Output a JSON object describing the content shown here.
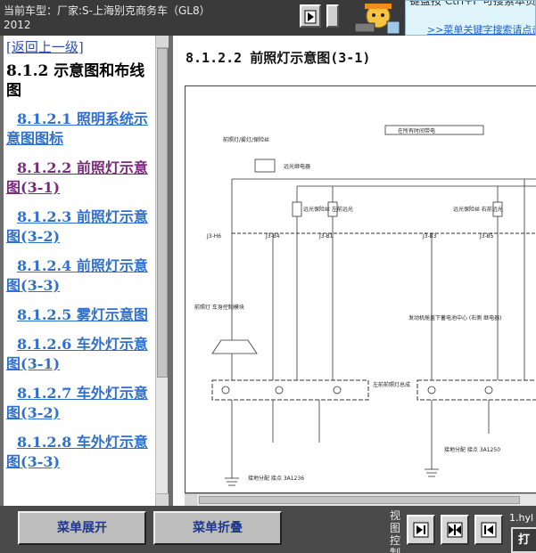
{
  "topbar": {
    "vehicle_line1": "当前车型：厂家:S-上海别克商务车（GL8）",
    "vehicle_line2": "2012",
    "hint_text": "键盘按 Ctrl+F 可搜索本页关键字!",
    "hint_link": ">>菜单关键字搜索请点击"
  },
  "toc": {
    "back_link": "[返回上一级]",
    "heading": "8.1.2 示意图和布线图",
    "items": [
      {
        "label": "8.1.2.1 照明系统示意图图标"
      },
      {
        "label": "8.1.2.2 前照灯示意图(3-1)"
      },
      {
        "label": "8.1.2.3 前照灯示意图(3-2)"
      },
      {
        "label": "8.1.2.4 前照灯示意图(3-3)"
      },
      {
        "label": "8.1.2.5 雾灯示意图"
      },
      {
        "label": "8.1.2.6 车外灯示意图(3-1)"
      },
      {
        "label": "8.1.2.7 车外灯示意图(3-2)"
      },
      {
        "label": "8.1.2.8 车外灯示意图(3-3)"
      }
    ]
  },
  "content": {
    "title": "8.1.2.2 前照灯示意图(3-1)"
  },
  "diagram": {
    "top_label": "在所有时间带电",
    "labels": {
      "fuse_area": "前照灯/雾灯/保险丝",
      "relay": "远光继电器",
      "j3_h6": "J3-H6",
      "j3_b4": "J3-B4",
      "j3_b1": "J3-B1",
      "j3_b3": "J3-B3",
      "j3_b5": "J3-B5",
      "fuse_left": "远光保险丝 左前远光",
      "fuse_right": "远光保险丝 右前远光",
      "left_headlamp_assembly": "左前前照灯总成",
      "ground_left": "接地分配 接点 3A1236",
      "ground_right": "接地分配 接点 3A1250",
      "headlamp_switch": "前照灯 车身控制模块",
      "right_module": "发动机舱盖下蓄电池中心 (右侧 继电器)"
    }
  },
  "bottombar": {
    "expand_label": "菜单展开",
    "collapse_label": "菜单折叠",
    "view_control_label": "视图控制",
    "filename": "1.hyl",
    "corner_label": "打"
  },
  "icons": {
    "topbar_btn_1": "arrow-right-icon",
    "mascot": "mascot-icon",
    "nav_1": "arrow-right-bar-icon",
    "nav_2": "expand-both-icon",
    "nav_3": "arrow-left-bar-icon"
  }
}
